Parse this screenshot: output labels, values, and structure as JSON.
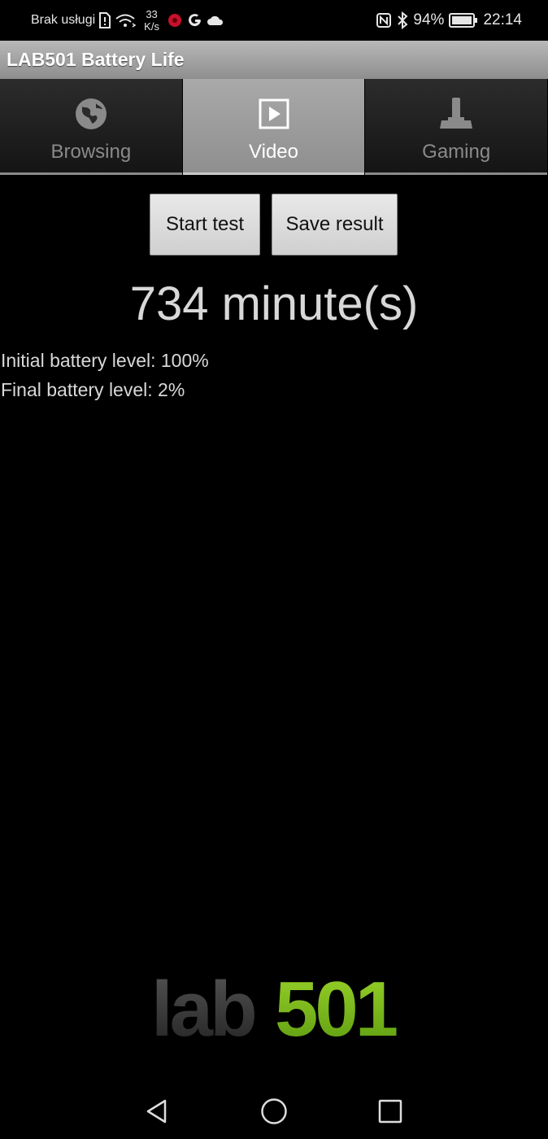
{
  "status_bar": {
    "carrier": "Brak usługi",
    "speed_value": "33",
    "speed_unit": "K/s",
    "battery_percent": "94%",
    "time": "22:14"
  },
  "app": {
    "title": "LAB501 Battery Life"
  },
  "tabs": [
    {
      "label": "Browsing",
      "icon": "globe-icon",
      "active": false
    },
    {
      "label": "Video",
      "icon": "play-icon",
      "active": true
    },
    {
      "label": "Gaming",
      "icon": "joystick-icon",
      "active": false
    }
  ],
  "actions": {
    "start_label": "Start test",
    "save_label": "Save result"
  },
  "result": {
    "duration": "734 minute(s)",
    "initial_battery": "Initial battery level: 100%",
    "final_battery": "Final battery level: 2%"
  },
  "logo": {
    "text_dark": "lab",
    "text_green": "501"
  },
  "colors": {
    "accent_green": "#7fc31c",
    "logo_dark": "#3a3a3a",
    "app_bar": "#a0a0a0"
  }
}
